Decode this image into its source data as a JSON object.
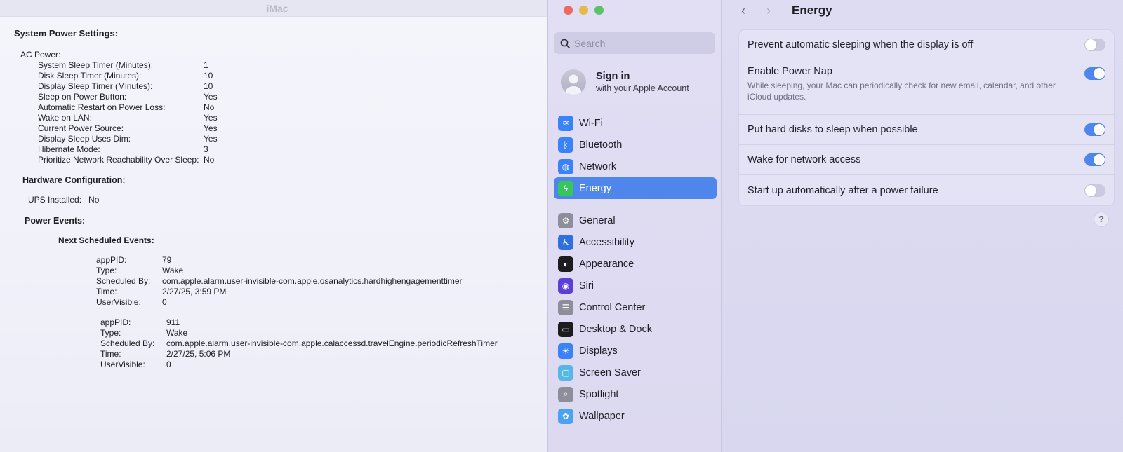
{
  "report": {
    "window_title": "iMac",
    "title": "System Power Settings:",
    "ac_power_label": "AC Power:",
    "ac_power": [
      {
        "key": "System Sleep Timer (Minutes):",
        "value": "1"
      },
      {
        "key": "Disk Sleep Timer (Minutes):",
        "value": "10"
      },
      {
        "key": "Display Sleep Timer (Minutes):",
        "value": "10"
      },
      {
        "key": "Sleep on Power Button:",
        "value": "Yes"
      },
      {
        "key": "Automatic Restart on Power Loss:",
        "value": "No"
      },
      {
        "key": "Wake on LAN:",
        "value": "Yes"
      },
      {
        "key": "Current Power Source:",
        "value": "Yes"
      },
      {
        "key": "Display Sleep Uses Dim:",
        "value": "Yes"
      },
      {
        "key": "Hibernate Mode:",
        "value": "3"
      },
      {
        "key": "Prioritize Network Reachability Over Sleep:",
        "value": "No"
      }
    ],
    "hardware_title": "Hardware Configuration:",
    "ups_key": "UPS Installed:",
    "ups_value": "No",
    "power_events_title": "Power Events:",
    "next_events_title": "Next Scheduled Events:",
    "events": [
      [
        {
          "key": "appPID:",
          "value": "79"
        },
        {
          "key": "Type:",
          "value": "Wake"
        },
        {
          "key": "Scheduled By:",
          "value": "com.apple.alarm.user-invisible-com.apple.osanalytics.hardhighengagementtimer"
        },
        {
          "key": "Time:",
          "value": "2/27/25, 3:59 PM"
        },
        {
          "key": "UserVisible:",
          "value": "0"
        }
      ],
      [
        {
          "key": "appPID:",
          "value": "911"
        },
        {
          "key": "Type:",
          "value": "Wake"
        },
        {
          "key": "Scheduled By:",
          "value": "com.apple.alarm.user-invisible-com.apple.calaccessd.travelEngine.periodicRefreshTimer"
        },
        {
          "key": "Time:",
          "value": "2/27/25, 5:06 PM"
        },
        {
          "key": "UserVisible:",
          "value": "0"
        }
      ]
    ]
  },
  "sidebar": {
    "search_placeholder": "Search",
    "account": {
      "title": "Sign in",
      "subtitle": "with your Apple Account"
    },
    "items": [
      {
        "label": "Wi-Fi",
        "icon": "wifi-icon",
        "color": "#3b82f6",
        "glyph": "≋"
      },
      {
        "label": "Bluetooth",
        "icon": "bluetooth-icon",
        "color": "#3b82f6",
        "glyph": "ᛒ"
      },
      {
        "label": "Network",
        "icon": "globe-icon",
        "color": "#3b82f6",
        "glyph": "◍"
      },
      {
        "label": "Energy",
        "icon": "energy-icon",
        "color": "#34c759",
        "glyph": "ϟ",
        "active": true
      },
      {
        "label": "General",
        "icon": "gear-icon",
        "color": "#8e8e9a",
        "glyph": "⚙"
      },
      {
        "label": "Accessibility",
        "icon": "accessibility-icon",
        "color": "#2f6fe0",
        "glyph": "♿"
      },
      {
        "label": "Appearance",
        "icon": "appearance-icon",
        "color": "#1c1c1e",
        "glyph": "◐"
      },
      {
        "label": "Siri",
        "icon": "siri-icon",
        "color": "#5b3fd6",
        "glyph": "◉"
      },
      {
        "label": "Control Center",
        "icon": "control-center-icon",
        "color": "#8e8e9a",
        "glyph": "☰"
      },
      {
        "label": "Desktop & Dock",
        "icon": "desktop-dock-icon",
        "color": "#1c1c1e",
        "glyph": "▭"
      },
      {
        "label": "Displays",
        "icon": "displays-icon",
        "color": "#3b82f6",
        "glyph": "☀"
      },
      {
        "label": "Screen Saver",
        "icon": "screen-saver-icon",
        "color": "#56b6e8",
        "glyph": "▢"
      },
      {
        "label": "Spotlight",
        "icon": "spotlight-icon",
        "color": "#8e8e9a",
        "glyph": "⌕"
      },
      {
        "label": "Wallpaper",
        "icon": "wallpaper-icon",
        "color": "#4aa3f0",
        "glyph": "✿"
      }
    ]
  },
  "pane": {
    "title": "Energy",
    "settings": [
      {
        "label": "Prevent automatic sleeping when the display is off",
        "on": false
      },
      {
        "label": "Enable Power Nap",
        "desc": "While sleeping, your Mac can periodically check for new email, calendar, and other iCloud updates.",
        "on": true
      },
      {
        "label": "Put hard disks to sleep when possible",
        "on": true
      },
      {
        "label": "Wake for network access",
        "on": true
      },
      {
        "label": "Start up automatically after a power failure",
        "on": false
      }
    ],
    "help_glyph": "?"
  }
}
